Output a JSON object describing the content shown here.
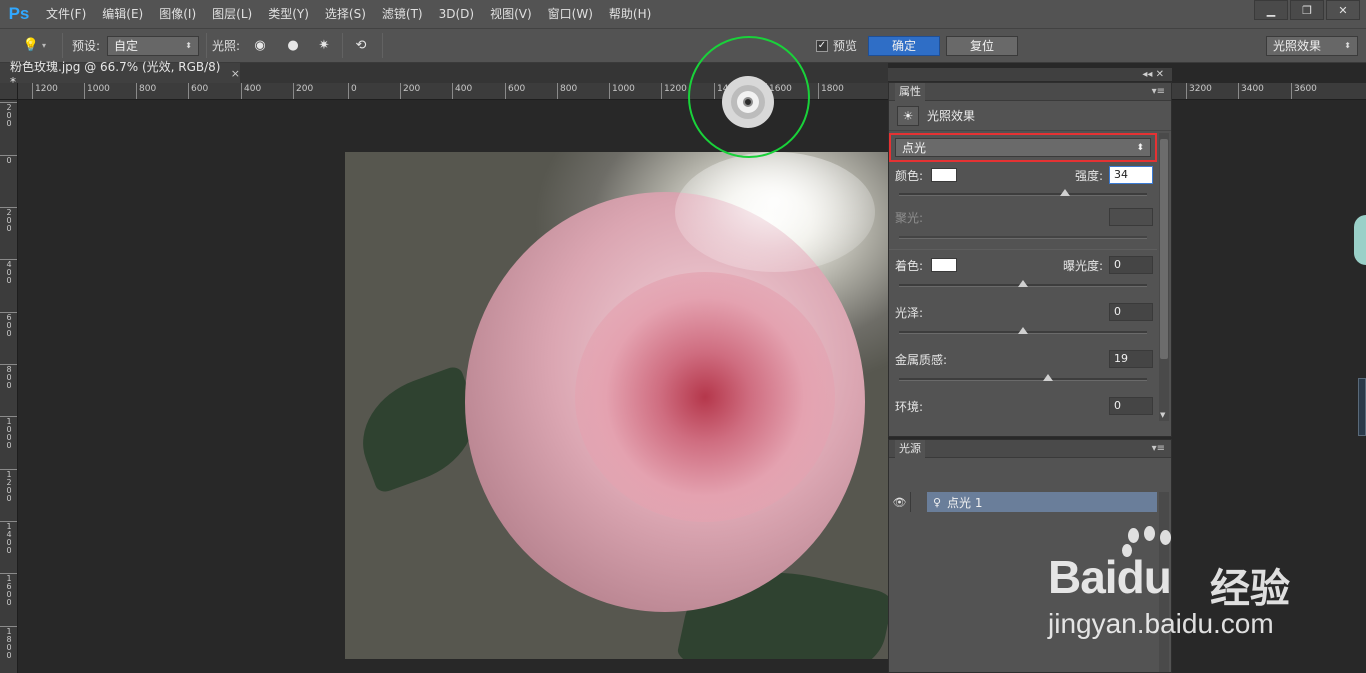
{
  "app": {
    "logo": "Ps",
    "accent": "#31a8ff"
  },
  "menu": [
    "文件(F)",
    "编辑(E)",
    "图像(I)",
    "图层(L)",
    "类型(Y)",
    "选择(S)",
    "滤镜(T)",
    "3D(D)",
    "视图(V)",
    "窗口(W)",
    "帮助(H)"
  ],
  "window_controls": {
    "minimize": "▁",
    "restore": "❐",
    "close": "✕"
  },
  "options": {
    "preset_label": "预设:",
    "preset_value": "自定",
    "light_label": "光照:",
    "preview_label": "预览",
    "preview_checked": "✓",
    "ok_label": "确定",
    "reset_label": "复位",
    "workspace_value": "光照效果"
  },
  "document": {
    "tab_title": "粉色玫瑰.jpg @ 66.7% (光效, RGB/8) *",
    "close": "×"
  },
  "rulers": {
    "top": [
      "1200",
      "1000",
      "800",
      "600",
      "400",
      "200",
      "0",
      "200",
      "400",
      "600",
      "800",
      "1000",
      "1200",
      "1400",
      "1600",
      "1800",
      "3200",
      "3400",
      "3600"
    ],
    "left": [
      "2\n0\n0",
      "0",
      "2\n0\n0",
      "4\n0\n0",
      "6\n0\n0",
      "8\n0\n0",
      "1\n0\n0\n0",
      "1\n2\n0\n0",
      "1\n4\n0\n0",
      "1\n6\n0\n0",
      "1\n8\n0\n0"
    ]
  },
  "properties": {
    "tab_label": "属性",
    "collapse": "◂◂ ✕",
    "menu": "▾≡",
    "title": "光照效果",
    "light_type": "点光",
    "color_label": "颜色:",
    "intensity_label": "强度:",
    "intensity_value": "34",
    "intensity_level": 0.67,
    "hotspot_label": "聚光:",
    "colorize_label": "着色:",
    "exposure_label": "曝光度:",
    "exposure_value": "0",
    "exposure_level": 0.5,
    "gloss_label": "光泽:",
    "gloss_value": "0",
    "gloss_level": 0.5,
    "metallic_label": "金属质感:",
    "metallic_value": "19",
    "metallic_level": 0.6,
    "ambience_label": "环境:",
    "ambience_value": "0"
  },
  "lights_panel": {
    "tab_label": "光源",
    "menu": "▾≡",
    "item_label": "点光 1"
  },
  "watermark": {
    "brand": "Bai",
    "brand_suffix": "du",
    "cn": "经验",
    "url": "jingyan.baidu.com"
  },
  "colors": {
    "highlight_border": "#e53233",
    "light_ring": "#19d23a",
    "primary_button": "#2f6ec6",
    "selected_row": "#6a7e9a"
  }
}
